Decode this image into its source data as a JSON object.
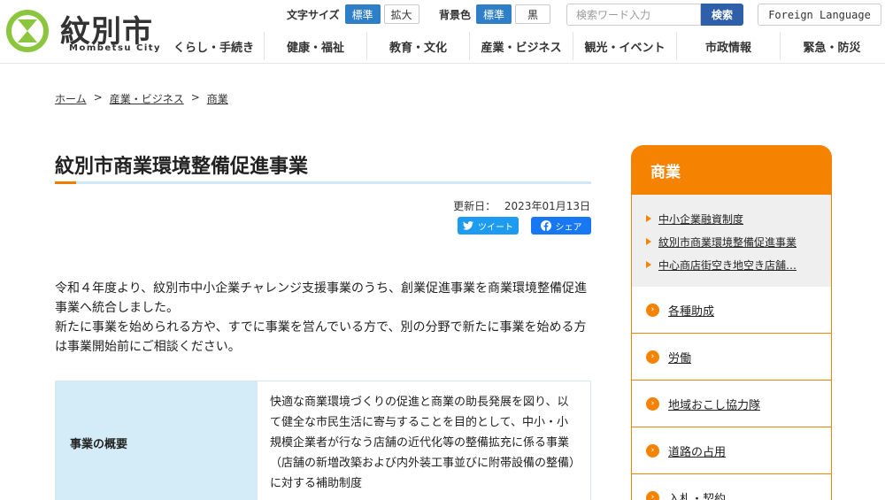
{
  "site": {
    "name": "紋別市",
    "name_sub": "Mombetsu City"
  },
  "toolbar": {
    "font_size_label": "文字サイズ",
    "font_standard": "標準",
    "font_large": "拡大",
    "bg_label": "背景色",
    "bg_standard": "標準",
    "bg_black": "黒",
    "search_placeholder": "検索ワード入力",
    "search_button": "検索",
    "language": "Foreign Language"
  },
  "nav": [
    {
      "label": "くらし・手続き"
    },
    {
      "label": "健康・福祉"
    },
    {
      "label": "教育・文化"
    },
    {
      "label": "産業・ビジネス"
    },
    {
      "label": "観光・イベント"
    },
    {
      "label": "市政情報"
    },
    {
      "label": "緊急・防災"
    }
  ],
  "breadcrumb": [
    "ホーム",
    ">",
    "産業・ビジネス",
    ">",
    "商業"
  ],
  "page": {
    "title": "紋別市商業環境整備促進事業",
    "updated_label": "更新日：",
    "updated_date": "2023年01月13日",
    "tweet": "ツイート",
    "share": "シェア",
    "intro_1": "令和４年度より、紋別市中小企業チャレンジ支援事業のうち、創業促進事業を商業環境整備促進事業へ統合しました。",
    "intro_2": "新たに事業を始められる方や、すでに事業を営んでいる方で、別の分野で新たに事業を始める方は事業開始前にご相談ください。",
    "table": {
      "header": "事業の概要",
      "body": "快適な商業環境づくりの促進と商業の助長発展を図り、以て健全な市民生活に寄与することを目的として、中小・小規模企業者が行なう店舗の近代化等の整備拡充に係る事業（店舗の新増改築および内外装工事並びに附帯設備の整備）に対する補助制度"
    }
  },
  "sidebar": {
    "title": "商業",
    "sub_items": [
      "中小企業融資制度",
      "紋別市商業環境整備促進事業",
      "中心商店街空き地空き店舗…"
    ],
    "items": [
      "各種助成",
      "労働",
      "地域おこし協力隊",
      "道路の占用",
      "入札・契約"
    ]
  },
  "colors": {
    "accent_orange": "#f58200",
    "brand_blue": "#2f7fc8",
    "logo_green": "#8cc63f"
  }
}
